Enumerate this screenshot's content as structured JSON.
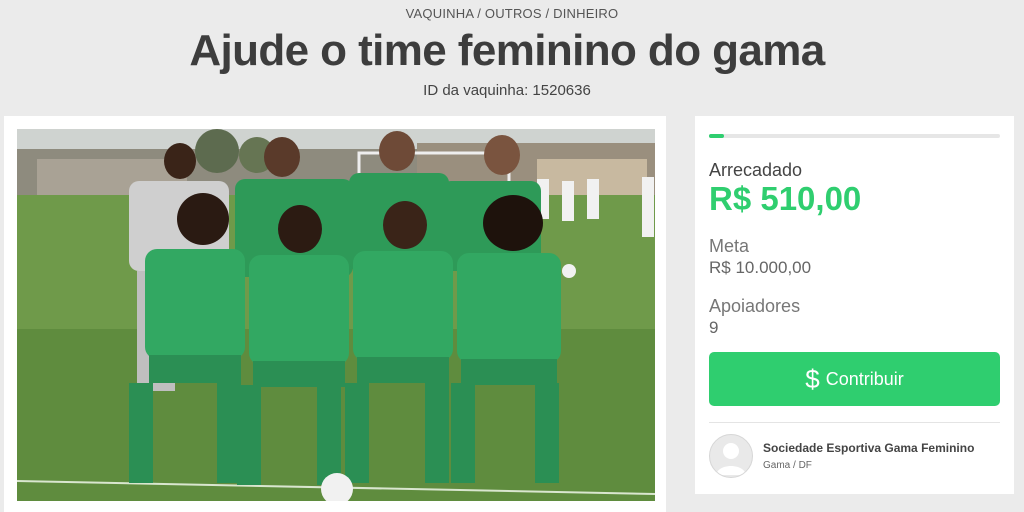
{
  "header": {
    "breadcrumb": "VAQUINHA / OUTROS / DINHEIRO",
    "title": "Ajude o time feminino do gama",
    "campaign_id": "ID da vaquinha: 1520636"
  },
  "photo": {
    "alt": "Women's football team in green jerseys posing on a field"
  },
  "stats": {
    "progress_fraction": 0.051,
    "raised_label": "Arrecadado",
    "raised_value": "R$ 510,00",
    "goal_label": "Meta",
    "goal_value": "R$ 10.000,00",
    "supporters_label": "Apoiadores",
    "supporters_value": "9"
  },
  "cta": {
    "icon": "dollar-icon",
    "label": "Contribuir"
  },
  "organizer": {
    "name": "Sociedade Esportiva Gama Feminino",
    "location": "Gama / DF"
  },
  "colors": {
    "accent": "#2fce6f",
    "background": "#ebebeb"
  }
}
